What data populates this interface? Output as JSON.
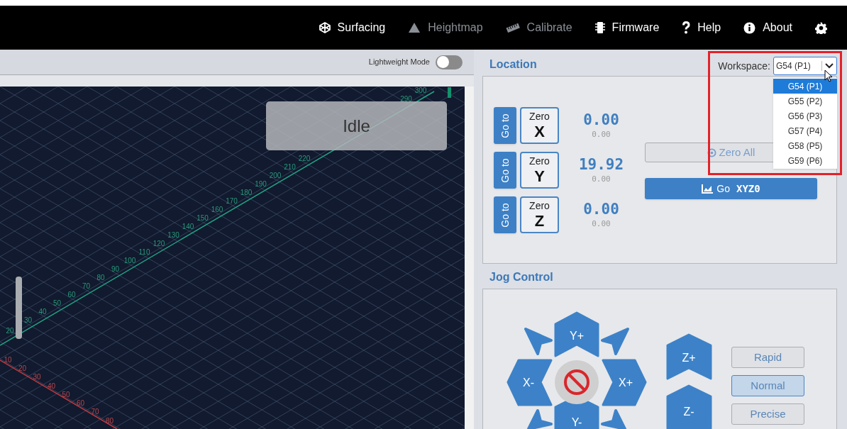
{
  "nav": [
    {
      "label": "Surfacing",
      "disabled": false
    },
    {
      "label": "Heightmap",
      "disabled": true
    },
    {
      "label": "Calibrate",
      "disabled": true
    },
    {
      "label": "Firmware",
      "disabled": false
    },
    {
      "label": "Help",
      "disabled": false
    },
    {
      "label": "About",
      "disabled": false
    }
  ],
  "visualizer": {
    "lightweight_mode": {
      "label": "Lightweight Mode",
      "on": false
    },
    "status": "Idle",
    "y_axis_labels": [
      "20",
      "30",
      "40",
      "50",
      "60",
      "70",
      "80",
      "90",
      "100",
      "110",
      "120",
      "130",
      "140",
      "150",
      "160",
      "170",
      "180",
      "190",
      "200",
      "210",
      "220"
    ],
    "y_axis_labels_far": [
      "290",
      "300"
    ],
    "x_axis_labels": [
      "10",
      "20",
      "30",
      "40",
      "50",
      "60",
      "70",
      "80"
    ]
  },
  "location": {
    "title": "Location",
    "workspace": {
      "label": "Workspace:",
      "value": "G54 (P1)",
      "expanded": true,
      "options": [
        {
          "label": "G54 (P1)",
          "selected": true
        },
        {
          "label": "G55 (P2)",
          "selected": false
        },
        {
          "label": "G56 (P3)",
          "selected": false
        },
        {
          "label": "G57 (P4)",
          "selected": false
        },
        {
          "label": "G58 (P5)",
          "selected": false
        },
        {
          "label": "G59 (P6)",
          "selected": false
        }
      ]
    },
    "axes": [
      {
        "goto": "Go to",
        "zero": "Zero",
        "axis": "X",
        "value": "0.00",
        "machine_value": "0.00"
      },
      {
        "goto": "Go to",
        "zero": "Zero",
        "axis": "Y",
        "value": "19.92",
        "machine_value": "0.00"
      },
      {
        "goto": "Go to",
        "zero": "Zero",
        "axis": "Z",
        "value": "0.00",
        "machine_value": "0.00"
      }
    ],
    "zero_all": "Zero All",
    "go_zero": {
      "label": "Go",
      "target": "XYZ0"
    }
  },
  "jog": {
    "title": "Jog Control",
    "buttons": [
      {
        "label": "Y+"
      },
      {
        "label": "X-"
      },
      {
        "label": "X+"
      },
      {
        "label": "Y-"
      },
      {
        "label": "Z+"
      },
      {
        "label": "Z-"
      }
    ],
    "speeds": [
      {
        "label": "Rapid",
        "selected": false
      },
      {
        "label": "Normal",
        "selected": true
      },
      {
        "label": "Precise",
        "selected": false
      }
    ]
  }
}
